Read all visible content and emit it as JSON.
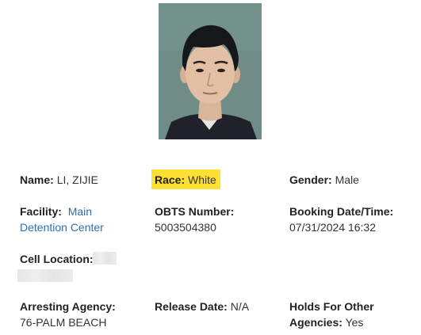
{
  "inmate": {
    "photo_alt": "Booking photo",
    "name_label": "Name:",
    "name_value": "LI, ZIJIE",
    "race_label": "Race:",
    "race_value": "White",
    "gender_label": "Gender:",
    "gender_value": "Male",
    "facility_label": "Facility:",
    "facility_line1": "Main",
    "facility_line2": "Detention Center",
    "obts_label": "OBTS Number:",
    "obts_value": "5003504380",
    "booking_label": "Booking Date/Time:",
    "booking_value": "07/31/2024 16:32",
    "cell_label": "Cell Location:",
    "agency_label": "Arresting Agency:",
    "agency_value": "76-PALM BEACH",
    "release_label": "Release Date:",
    "release_value": "N/A",
    "holds_label_line1": "Holds For Other",
    "holds_label_line2": "Agencies:",
    "holds_value": "Yes"
  },
  "colors": {
    "highlight": "#ffe033",
    "link": "#2f6fa8",
    "label": "#222222",
    "value": "#333333",
    "photo_background": "#6f8d86"
  },
  "icons": {
    "photo": "person-photo"
  }
}
